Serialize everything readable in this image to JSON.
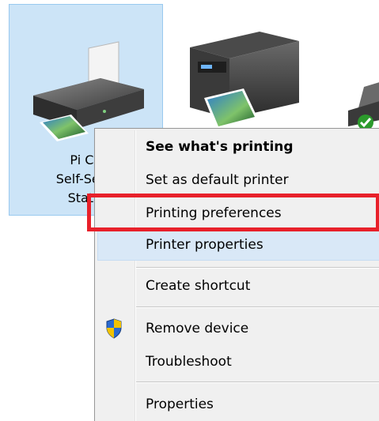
{
  "devices": {
    "selected": {
      "label_lines": [
        "Pi Ch",
        "Self-Servi",
        "Static"
      ]
    }
  },
  "context_menu": {
    "items": [
      {
        "label": "See what's printing"
      },
      {
        "label": "Set as default printer"
      },
      {
        "label": "Printing preferences"
      },
      {
        "label": "Printer properties"
      },
      {
        "label": "Create shortcut"
      },
      {
        "label": "Remove device"
      },
      {
        "label": "Troubleshoot"
      },
      {
        "label": "Properties"
      }
    ]
  },
  "annotation": {
    "highlight_color": "#e8202a",
    "hover_color": "#d9e8f7"
  },
  "icons": {
    "selected_device": "printer-icon",
    "second_device": "multifunction-printer-icon",
    "third_device": "printer-icon",
    "remove_device": "uac-shield-icon"
  }
}
